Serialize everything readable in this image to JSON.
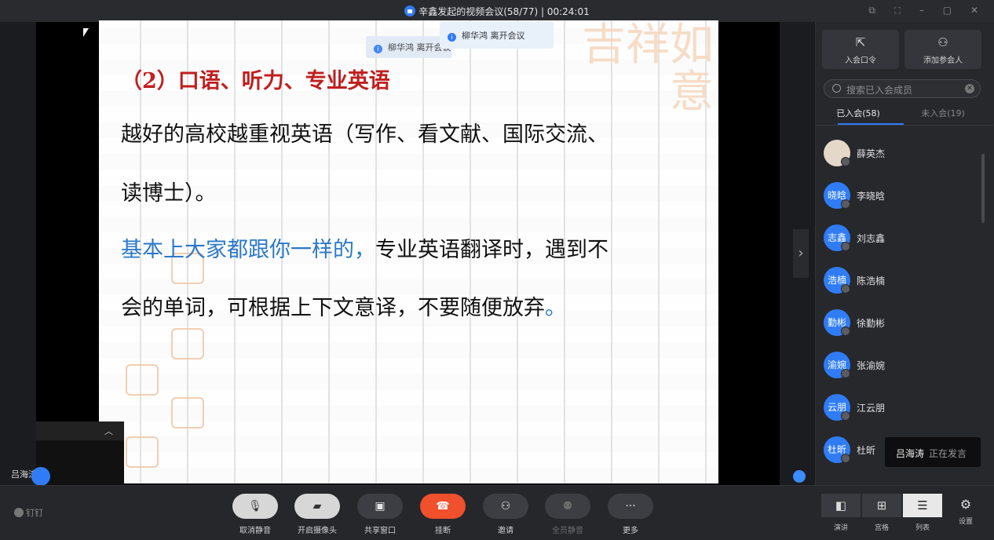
{
  "window": {
    "title": "辛鑫发起的视频会议(58/77) | 00:24:01",
    "controls": "⧉ ⛶ – ▢ ✕"
  },
  "slide": {
    "heading": "（2）口语、听力、专业英语",
    "line1": "越好的高校越重视英语（写作、看文献、国际交流、",
    "line2": "读博士）。",
    "line3_blue": "基本上大家都跟你一样的，",
    "line3_rest": "专业英语翻译时，遇到不",
    "line4": "会的单词，可根据上下文意译，不要随便放弃",
    "line4_end": "。",
    "watermark": "吉祥如意",
    "seal": "吉祥如意"
  },
  "notifications": [
    {
      "text": "柳华鸿 离开会议"
    },
    {
      "text": "柳华鸿 离开会议"
    }
  ],
  "self_view": {
    "name": "吕海涛"
  },
  "panel": {
    "invite_code_label": "入会口令",
    "add_participant_label": "添加参会人",
    "search_placeholder": "搜索已入会成员",
    "tab_joined": "已入会(58)",
    "tab_not_joined": "未入会(19)",
    "members": [
      {
        "name": "薛英杰",
        "avatar": ""
      },
      {
        "name": "李晓晗",
        "avatar": "晓晗"
      },
      {
        "name": "刘志鑫",
        "avatar": "志鑫"
      },
      {
        "name": "陈浩楠",
        "avatar": "浩楠"
      },
      {
        "name": "徐勤彬",
        "avatar": "勤彬"
      },
      {
        "name": "张渝婉",
        "avatar": "渝婉"
      },
      {
        "name": "江云朋",
        "avatar": "云朋"
      },
      {
        "name": "杜昕",
        "avatar": "杜昕"
      }
    ]
  },
  "speaking": {
    "name": "吕海涛",
    "status": "正在发言"
  },
  "toolbar": {
    "brand": "钉钉",
    "unmute": "取消静音",
    "camera": "开启摄像头",
    "share": "共享窗口",
    "hangup": "挂断",
    "invite": "邀请",
    "mute_all": "全员静音",
    "more": "更多",
    "view_speaker": "演讲",
    "view_grid": "宫格",
    "view_list": "列表",
    "settings": "设置"
  },
  "colors": {
    "accent": "#2f7cf6",
    "hangup": "#f0502c",
    "slide_heading": "#c01f1f",
    "slide_blue": "#2b79c8"
  }
}
